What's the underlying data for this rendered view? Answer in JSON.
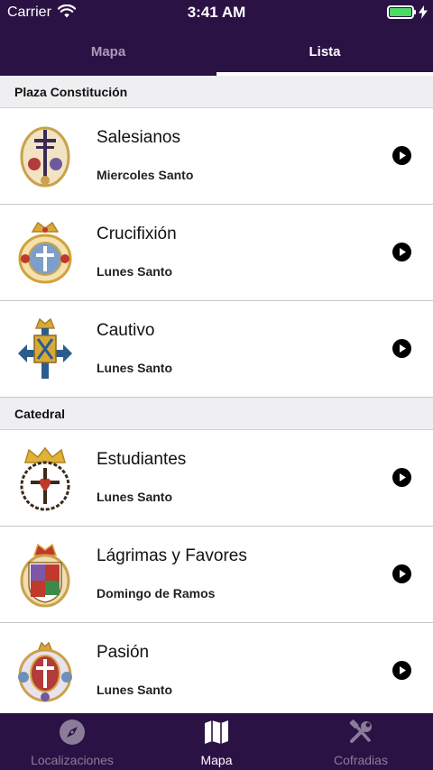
{
  "status_bar": {
    "carrier": "Carrier",
    "time": "3:41 AM"
  },
  "top_tabs": [
    {
      "label": "Mapa",
      "active": false
    },
    {
      "label": "Lista",
      "active": true
    }
  ],
  "sections": [
    {
      "title": "Plaza Constitución",
      "rows": [
        {
          "name": "Salesianos",
          "day": "Miercoles Santo",
          "emblem": "salesianos-emblem-icon"
        },
        {
          "name": "Crucifixión",
          "day": "Lunes Santo",
          "emblem": "crucifixion-emblem-icon"
        },
        {
          "name": "Cautivo",
          "day": "Lunes Santo",
          "emblem": "cautivo-emblem-icon"
        }
      ]
    },
    {
      "title": "Catedral",
      "rows": [
        {
          "name": "Estudiantes",
          "day": "Lunes Santo",
          "emblem": "estudiantes-emblem-icon"
        },
        {
          "name": "Lágrimas y Favores",
          "day": "Domingo de Ramos",
          "emblem": "lagrimas-emblem-icon"
        },
        {
          "name": "Pasión",
          "day": "Lunes Santo",
          "emblem": "pasion-emblem-icon"
        }
      ]
    }
  ],
  "bottom_tabs": [
    {
      "label": "Localizaciones",
      "icon": "compass-icon",
      "active": false
    },
    {
      "label": "Mapa",
      "icon": "map-icon",
      "active": true
    },
    {
      "label": "Cofradias",
      "icon": "tools-icon",
      "active": false
    }
  ],
  "colors": {
    "bar_bg": "#2b1245",
    "section_bg": "#efeff1",
    "battery": "#4cd964"
  }
}
